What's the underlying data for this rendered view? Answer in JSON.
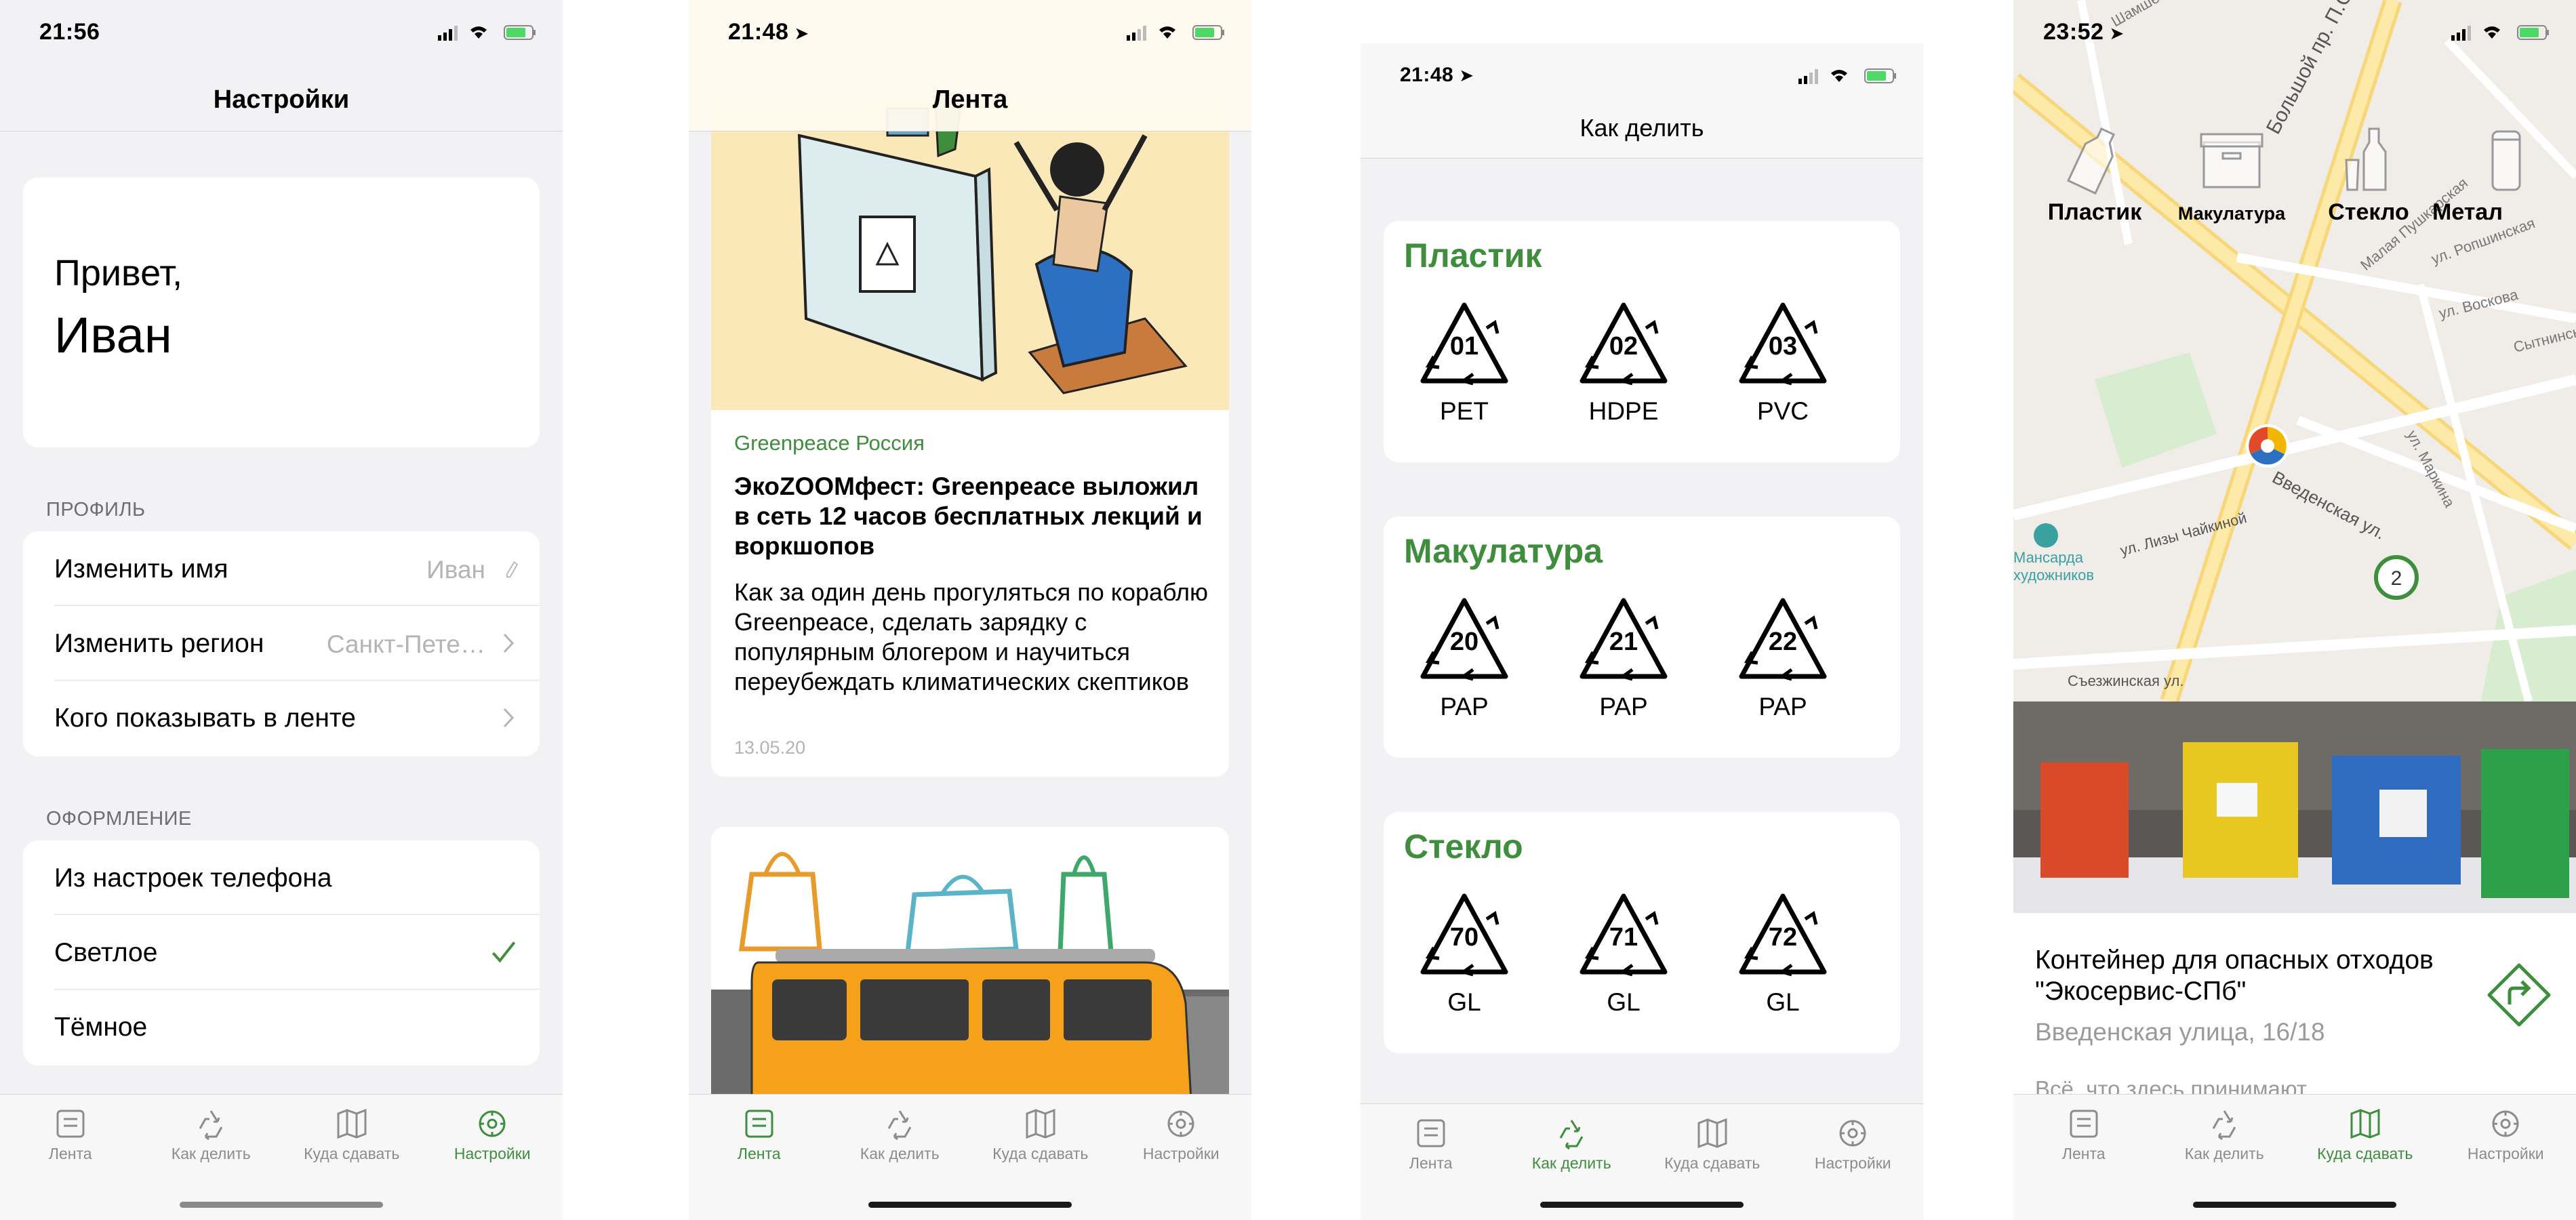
{
  "colors": {
    "accent": "#3e8e3e",
    "inactive": "#8c8c8c",
    "background": "#f2f2f4"
  },
  "tabs": [
    {
      "label": "Лента",
      "icon": "feed-icon"
    },
    {
      "label": "Как делить",
      "icon": "recycle-icon"
    },
    {
      "label": "Куда сдавать",
      "icon": "map-icon"
    },
    {
      "label": "Настройки",
      "icon": "settings-icon"
    }
  ],
  "screen1": {
    "time": "21:56",
    "title": "Настройки",
    "greeting_line1": "Привет,",
    "greeting_name": "Иван",
    "profile_header": "ПРОФИЛЬ",
    "profile_rows": [
      {
        "label": "Изменить имя",
        "value": "Иван"
      },
      {
        "label": "Изменить регион",
        "value": "Санкт-Пете…"
      },
      {
        "label": "Кого показывать в ленте",
        "value": ""
      }
    ],
    "appearance_header": "ОФОРМЛЕНИЕ",
    "appearance_rows": [
      {
        "label": "Из настроек телефона",
        "selected": false
      },
      {
        "label": "Светлое",
        "selected": true
      },
      {
        "label": "Тёмное",
        "selected": false
      }
    ],
    "active_tab": "Настройки"
  },
  "screen2": {
    "time": "21:48",
    "title": "Лента",
    "card1": {
      "source": "Greenpeace Россия",
      "headline": "ЭкоZOOMфест: Greenpeace выложил в сеть 12 часов бесплатных лекций и воркшопов",
      "body": "Как за один день прогуляться по кораблю Greenpeace, сделать зарядку с популярным блогером и научиться переубеждать климатических скептиков",
      "date": "13.05.20"
    },
    "active_tab": "Лента"
  },
  "screen3": {
    "time": "21:48",
    "title": "Как делить",
    "groups": [
      {
        "title": "Пластик",
        "symbols": [
          {
            "num": "01",
            "code": "PET"
          },
          {
            "num": "02",
            "code": "HDPE"
          },
          {
            "num": "03",
            "code": "PVC"
          }
        ]
      },
      {
        "title": "Макулатура",
        "symbols": [
          {
            "num": "20",
            "code": "PAP"
          },
          {
            "num": "21",
            "code": "PAP"
          },
          {
            "num": "22",
            "code": "PAP"
          }
        ]
      },
      {
        "title": "Стекло",
        "symbols": [
          {
            "num": "70",
            "code": "GL"
          },
          {
            "num": "71",
            "code": "GL"
          },
          {
            "num": "72",
            "code": "GL"
          }
        ]
      }
    ],
    "active_tab": "Как делить"
  },
  "screen4": {
    "time": "23:52",
    "categories": [
      {
        "label": "Пластик",
        "icon": "bottle-icon"
      },
      {
        "label": "Макулатура",
        "icon": "box-icon"
      },
      {
        "label": "Стекло",
        "icon": "glass-icon"
      },
      {
        "label": "Метал",
        "icon": "can-icon"
      }
    ],
    "streets": [
      "Шамшева ул.",
      "Большой пр. П.С.",
      "ул. Ропшинская",
      "Малая Пушкарская",
      "ул. Воскова",
      "Сытнинская",
      "ул. Маркина",
      "Введенская ул.",
      "ул. Лизы Чайкиной",
      "Съезжинская ул."
    ],
    "poi": "Мансарда художников",
    "cluster_count": "2",
    "place_title": "Контейнер для опасных отходов \"Экосервис-СПб\"",
    "place_address": "Введенская улица, 16/18",
    "place_more": "Всё, что здесь принимают",
    "active_tab": "Куда сдавать"
  }
}
